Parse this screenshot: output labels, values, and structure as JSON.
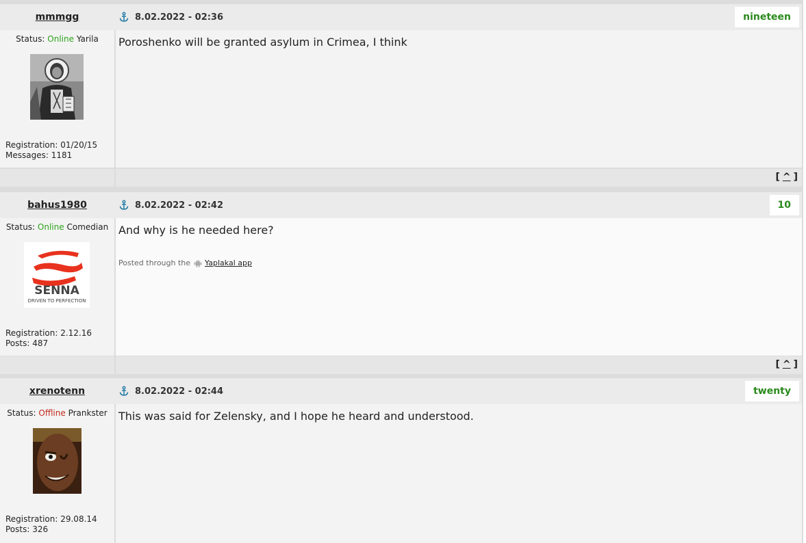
{
  "posts": [
    {
      "username": "mmmgg",
      "date": "8.02.2022 - 02:36",
      "rating": "nineteen",
      "status_label": "Status:",
      "status_value": "Online",
      "status_title": "Yarila",
      "message": "Poroshenko will be granted asylum in Crimea, I think",
      "registration": "Registration: 01/20/15",
      "count": "Messages: 1181",
      "avatar_icon": "icon-portrait-avatar"
    },
    {
      "username": "bahus1980",
      "date": "8.02.2022 - 02:42",
      "rating": "10",
      "status_label": "Status:",
      "status_value": "Online",
      "status_title": "Comedian",
      "message": "And why is he needed here?",
      "via_prefix": "Posted through the",
      "via_link": "Yaplakal app",
      "registration": "Registration: 2.12.16",
      "count": "Posts: 487",
      "avatar_icon": "senna-logo-avatar",
      "avatar_text_big": "SENNA",
      "avatar_text_small": "DRIVEN TO PERFECTION"
    },
    {
      "username": "xrenotenn",
      "date": "8.02.2022 - 02:44",
      "rating": "twenty",
      "status_label": "Status:",
      "status_value": "Offline",
      "status_title": "Prankster",
      "message": "This was said for Zelensky, and I hope he heard and understood.",
      "registration": "Registration: 29.08.14",
      "count": "Posts: 326",
      "avatar_icon": "face-photo-avatar"
    }
  ],
  "footer_up": {
    "open": "[",
    "caret": "^",
    "close": "]"
  },
  "colors": {
    "online": "#2ea31c",
    "offline": "#c0281c",
    "rating": "#2b8a1d",
    "anchor": "#2a7fa8"
  }
}
